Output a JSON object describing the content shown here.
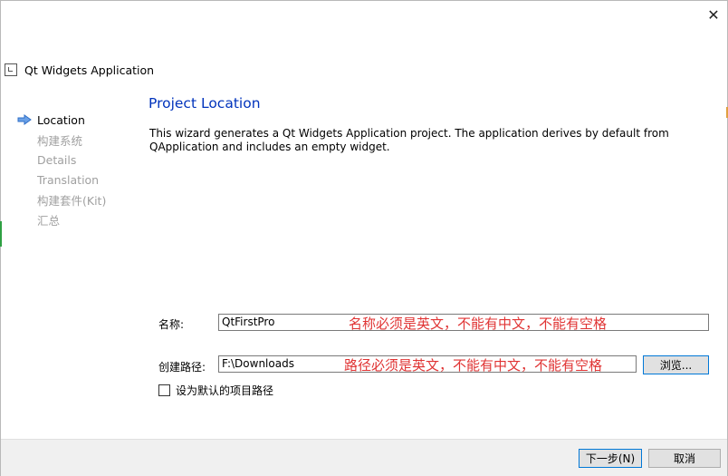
{
  "window": {
    "title": "Qt Widgets Application",
    "close_glyph": "✕"
  },
  "steps": [
    {
      "label": "Location",
      "active": true
    },
    {
      "label": "构建系统",
      "active": false
    },
    {
      "label": "Details",
      "active": false
    },
    {
      "label": "Translation",
      "active": false
    },
    {
      "label": "构建套件(Kit)",
      "active": false
    },
    {
      "label": "汇总",
      "active": false
    }
  ],
  "page": {
    "title": "Project Location",
    "description_line1": "This wizard generates a Qt Widgets Application project. The application derives by default from",
    "description_line2": "QApplication and includes an empty widget."
  },
  "form": {
    "name_label": "名称:",
    "name_value": "QtFirstPro",
    "name_annotation": "名称必须是英文，不能有中文，不能有空格",
    "path_label": "创建路径:",
    "path_value": "F:\\Downloads",
    "path_annotation": "路径必须是英文，不能有中文，不能有空格",
    "browse_label": "浏览...",
    "default_path_label": "设为默认的项目路径",
    "default_path_checked": false
  },
  "footer": {
    "next_label": "下一步(N)",
    "cancel_label": "取消"
  },
  "colors": {
    "accent": "#0078d7",
    "page_title": "#0033bc",
    "annotation": "#e03434",
    "inactive_step": "#a0a0a0"
  },
  "icons": {
    "active_step": "right-arrow-icon",
    "title": "app-window-icon",
    "close": "close-icon"
  }
}
